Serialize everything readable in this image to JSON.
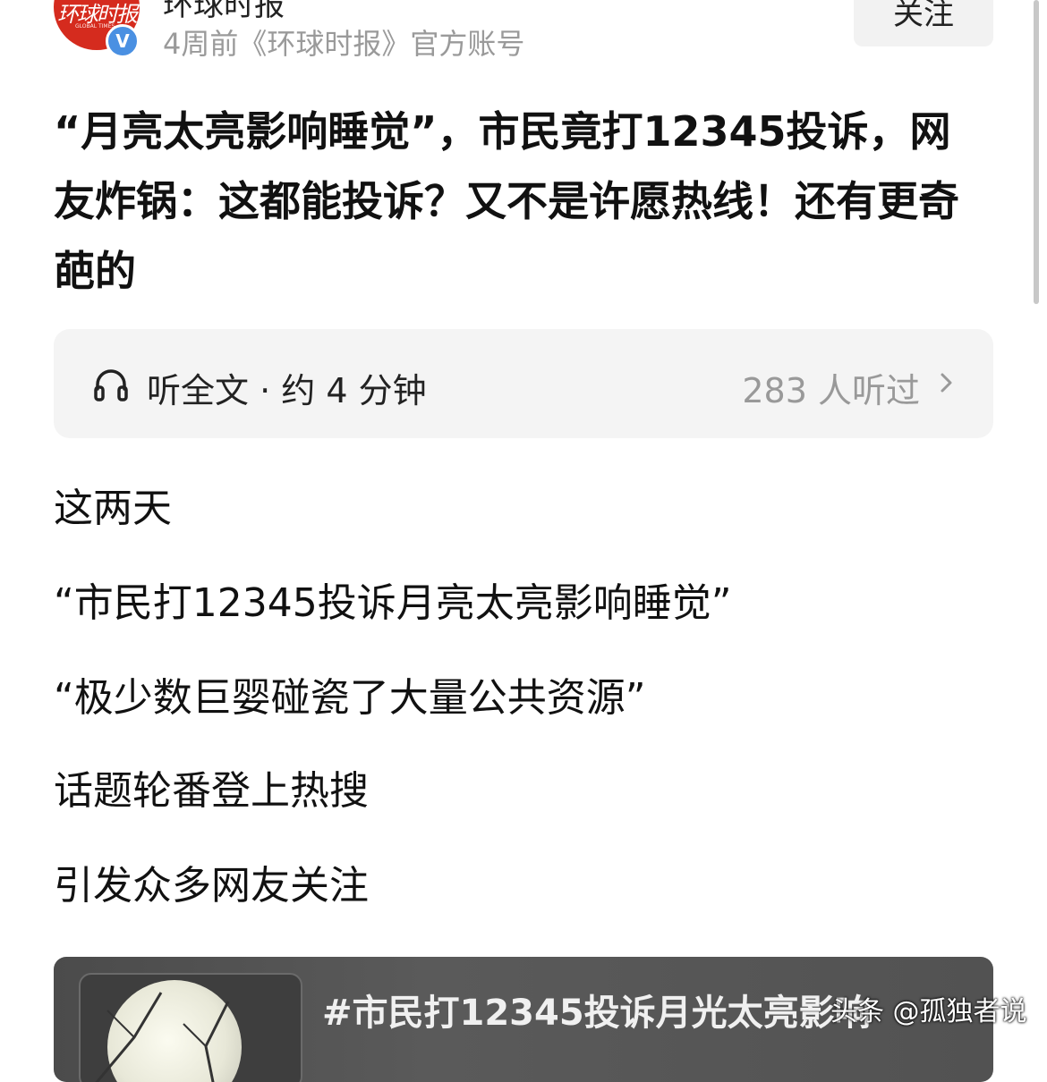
{
  "header": {
    "account_name": "环球时报",
    "avatar_text": "环球时报",
    "avatar_subtext": "GLOBAL TIMES",
    "verified_mark": "V",
    "meta": "4周前《环球时报》官方账号",
    "follow_label": "关注"
  },
  "article": {
    "title": "“月亮太亮影响睡觉”，市民竟打12345投诉，网友炸锅：这都能投诉？又不是许愿热线！还有更奇葩的",
    "paragraphs": [
      "这两天",
      "“市民打12345投诉月亮太亮影响睡觉”",
      "“极少数巨婴碰瓷了大量公共资源”",
      "话题轮番登上热搜",
      "引发众多网友关注"
    ]
  },
  "audio": {
    "label": "听全文 · 约 4 分钟",
    "listen_count": "283 人听过",
    "icon": "headphones-icon"
  },
  "card": {
    "title": "#市民打12345投诉月光太亮影响"
  },
  "watermark": "头条 @孤独者说",
  "colors": {
    "brand_red": "#d52b1e",
    "verified_blue": "#4a90e2",
    "muted_text": "#9a9a9a",
    "audio_bg": "#f4f4f4"
  }
}
